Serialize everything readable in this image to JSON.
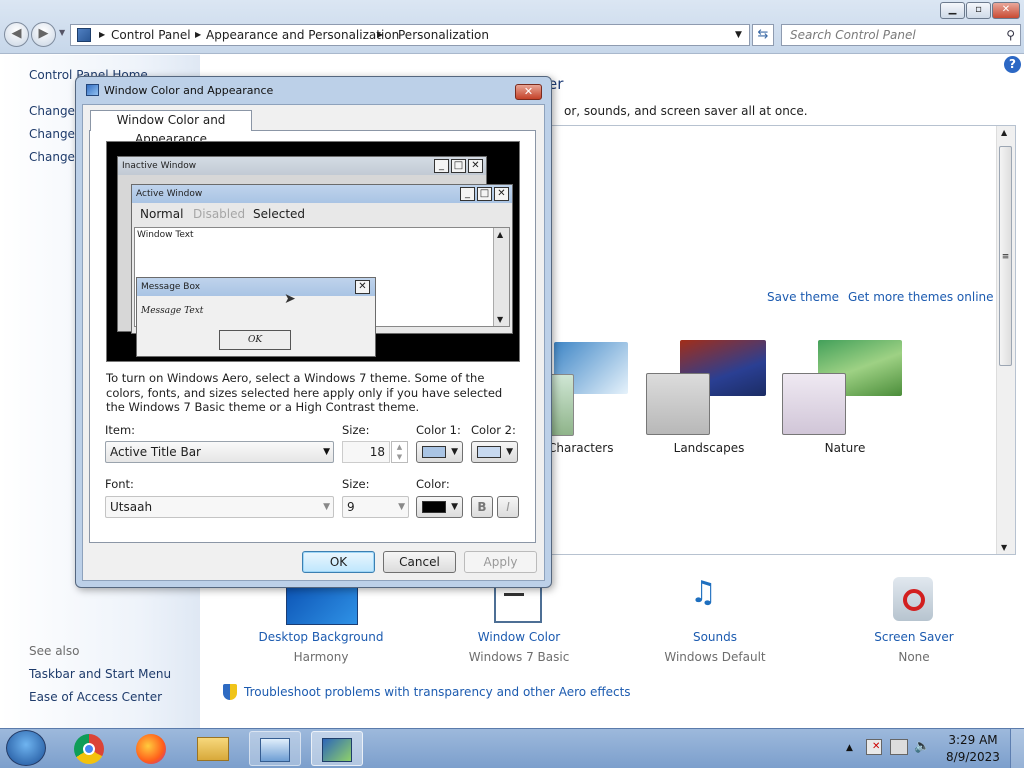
{
  "window": {
    "caption_min": "▁",
    "caption_max": "▫",
    "caption_close": "✕"
  },
  "nav": {
    "back": "◀",
    "forward": "▶",
    "breadcrumb": [
      "Control Panel",
      "Appearance and Personalization",
      "Personalization"
    ],
    "search_placeholder": "Search Control Panel"
  },
  "left_pane": {
    "home": "Control Panel Home",
    "links": [
      "Change desktop icons",
      "Change mouse pointers",
      "Change your account picture"
    ],
    "see_also_heading": "See also",
    "see_also": [
      "Taskbar and Start Menu",
      "Ease of Access Center"
    ]
  },
  "main": {
    "heading_partial": "er",
    "subtitle_partial": "or, sounds, and screen saver all at once.",
    "save_theme": "Save theme",
    "get_more_themes": "Get more themes online",
    "themes": [
      {
        "name": "Characters"
      },
      {
        "name": "Landscapes"
      },
      {
        "name": "Nature"
      }
    ],
    "bottom_items": [
      {
        "label": "Desktop Background",
        "sub": "Harmony"
      },
      {
        "label": "Window Color",
        "sub": "Windows 7 Basic"
      },
      {
        "label": "Sounds",
        "sub": "Windows Default"
      },
      {
        "label": "Screen Saver",
        "sub": "None"
      }
    ],
    "troubleshoot": "Troubleshoot problems with transparency and other Aero effects"
  },
  "dialog": {
    "title": "Window Color and Appearance",
    "tab": "Window Color and Appearance",
    "preview": {
      "inactive_title": "Inactive Window",
      "active_title": "Active Window",
      "menu_normal": "Normal",
      "menu_disabled": "Disabled",
      "menu_selected": "Selected",
      "window_text": "Window Text",
      "msgbox_title": "Message Box",
      "msgbox_text": "Message Text",
      "msgbox_ok": "OK"
    },
    "info": "To turn on Windows Aero, select a Windows 7 theme.  Some of the colors, fonts, and sizes selected here apply only if you have selected the Windows 7 Basic theme or a High Contrast theme.",
    "item_label": "Item:",
    "item_value": "Active Title Bar",
    "size_label": "Size:",
    "size_value": "18",
    "color1_label": "Color 1:",
    "color2_label": "Color 2:",
    "color1": "#a9c4e4",
    "color2": "#c7d9f0",
    "font_label": "Font:",
    "font_value": "Utsaah",
    "font_size_label": "Size:",
    "font_size_value": "9",
    "font_color_label": "Color:",
    "font_color": "#000000",
    "bold": "B",
    "italic": "I",
    "ok": "OK",
    "cancel": "Cancel",
    "apply": "Apply"
  },
  "taskbar": {
    "clock_time": "3:29 AM",
    "clock_date": "8/9/2023",
    "tray_arrow": "▲"
  }
}
